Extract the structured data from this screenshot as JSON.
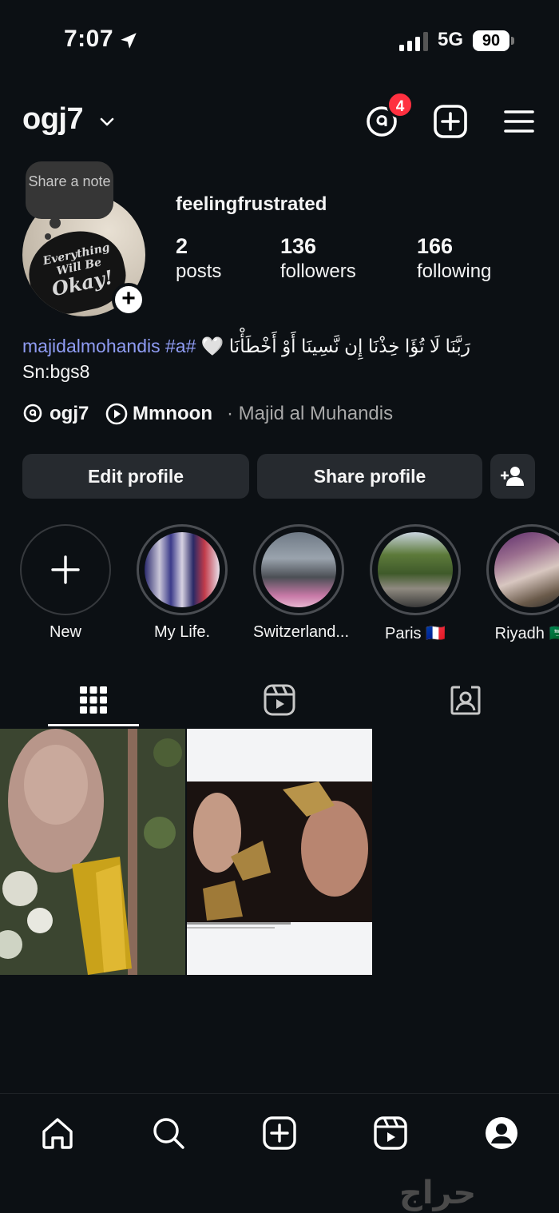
{
  "status_bar": {
    "time": "7:07",
    "network": "5G",
    "battery": "90"
  },
  "header": {
    "username": "ogj7",
    "threads_badge": "4"
  },
  "profile": {
    "note_placeholder": "Share a note",
    "avatar_text_top": "Everything Will Be",
    "avatar_text_big": "Okay!",
    "display_name": "feelingfrustrated",
    "stats": [
      {
        "value": "2",
        "label": "posts"
      },
      {
        "value": "136",
        "label": "followers"
      },
      {
        "value": "166",
        "label": "following"
      }
    ],
    "bio_arabic": "رَبَّنَا لَا تُؤَا خِذْنَا إِن نَّسِينَا أَوْ أَخْطَأْنَا",
    "bio_heart": "🤍",
    "bio_link": "majidalmohandis #a#",
    "bio_line2": "Sn:bgs8",
    "threads_name": "ogj7",
    "music_title": "Mmnoon",
    "music_artist": "· Majid al Muhandis"
  },
  "buttons": {
    "edit": "Edit profile",
    "share": "Share profile"
  },
  "highlights": [
    {
      "label": "New"
    },
    {
      "label": "My Life."
    },
    {
      "label": "Switzerland..."
    },
    {
      "label": "Paris 🇫🇷"
    },
    {
      "label": "Riyadh 🇸🇦"
    }
  ],
  "icons": {
    "tabs": [
      "grid-icon",
      "reels-icon",
      "tagged-icon"
    ],
    "bottom_nav": [
      "home-icon",
      "search-icon",
      "create-icon",
      "reels-icon",
      "profile-icon"
    ]
  },
  "watermark": "حراج",
  "colors": {
    "background": "#0c1014",
    "button": "#262a2f",
    "link": "#8f9cf3",
    "badge": "#ff3040"
  }
}
